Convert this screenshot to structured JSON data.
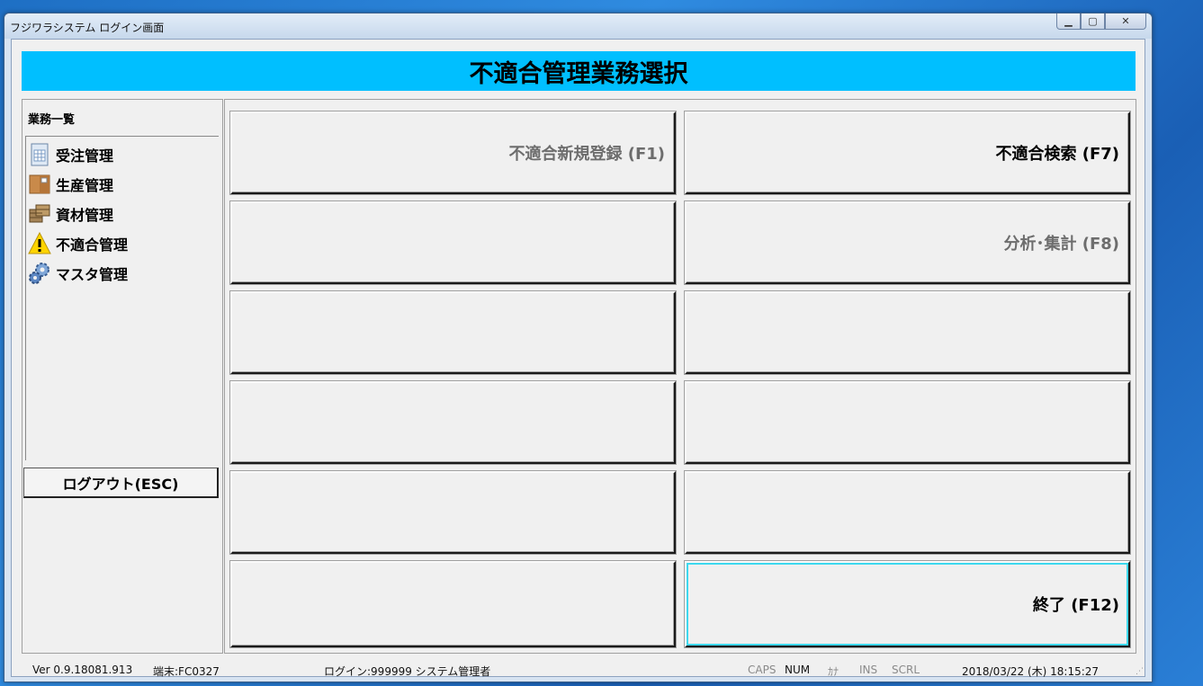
{
  "window": {
    "title": "フジワラシステム ログイン画面",
    "controls": {
      "minimize": "▁",
      "maximize": "▢",
      "close": "✕"
    }
  },
  "header": {
    "title": "不適合管理業務選択"
  },
  "sidebar": {
    "title": "業務一覧",
    "items": [
      {
        "label": "受注管理",
        "icon": "document-icon"
      },
      {
        "label": "生産管理",
        "icon": "box-icon"
      },
      {
        "label": "資材管理",
        "icon": "crates-icon"
      },
      {
        "label": "不適合管理",
        "icon": "warning-icon"
      },
      {
        "label": "マスタ管理",
        "icon": "gears-icon"
      }
    ],
    "logout_label": "ログアウト(ESC)"
  },
  "function_buttons": {
    "f1": "不適合新規登録 (F1)",
    "f7": "不適合検索 (F7)",
    "f8": "分析･集計 (F8)",
    "f12": "終了 (F12)"
  },
  "status_bar": {
    "version": "Ver 0.9.18081.913",
    "terminal": "端末:FC0327",
    "login": "ログイン:999999 システム管理者",
    "caps": "CAPS",
    "num": "NUM",
    "kana": "ｶﾅ",
    "ins": "INS",
    "scrl": "SCRL",
    "datetime": "2018/03/22 (木) 18:15:27"
  },
  "colors": {
    "header_bg": "#00bfff",
    "focus_border": "#3dd8ee",
    "desktop": "#2a7fd6"
  }
}
